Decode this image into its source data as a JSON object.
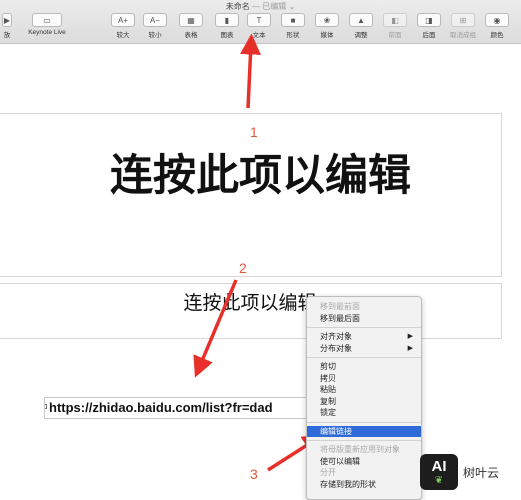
{
  "window": {
    "doc_title": "未命名",
    "doc_status": "— 已编辑 ⌄"
  },
  "toolbar": {
    "items": [
      {
        "label": "放",
        "glyph": "▶",
        "icon": "play-icon",
        "enabled": true
      },
      {
        "label": "Keynote Live",
        "glyph": "▭",
        "icon": "keynote-live-icon",
        "enabled": true
      },
      {
        "label": "较大",
        "glyph": "A+",
        "icon": "font-larger-icon",
        "enabled": true
      },
      {
        "label": "较小",
        "glyph": "A−",
        "icon": "font-smaller-icon",
        "enabled": true
      },
      {
        "label": "表格",
        "glyph": "▦",
        "icon": "table-icon",
        "enabled": true
      },
      {
        "label": "图表",
        "glyph": "▮",
        "icon": "chart-icon",
        "enabled": true
      },
      {
        "label": "文本",
        "glyph": "T",
        "icon": "text-icon",
        "enabled": true
      },
      {
        "label": "形状",
        "glyph": "■",
        "icon": "shape-icon",
        "enabled": true
      },
      {
        "label": "媒体",
        "glyph": "❀",
        "icon": "media-icon",
        "enabled": true
      },
      {
        "label": "调整",
        "glyph": "▲",
        "icon": "adjust-icon",
        "enabled": true
      },
      {
        "label": "前面",
        "glyph": "◧",
        "icon": "bring-front-icon",
        "enabled": false
      },
      {
        "label": "后面",
        "glyph": "◨",
        "icon": "send-back-icon",
        "enabled": true
      },
      {
        "label": "取消成组",
        "glyph": "⊞",
        "icon": "ungroup-icon",
        "enabled": false
      },
      {
        "label": "颜色",
        "glyph": "◉",
        "icon": "color-wheel-icon",
        "enabled": true
      }
    ]
  },
  "slide": {
    "title": "连按此项以编辑",
    "subtitle": "连按此项以编辑",
    "url_text": "https://zhidao.baidu.com/list?fr=dad"
  },
  "annotations": {
    "one": "1",
    "two": "2",
    "three": "3"
  },
  "context_menu": {
    "items": [
      {
        "label": "移到最前面",
        "disabled": true
      },
      {
        "label": "移到最后面"
      },
      {
        "sep": true
      },
      {
        "label": "对齐对象",
        "submenu": true
      },
      {
        "label": "分布对象",
        "submenu": true
      },
      {
        "sep": true
      },
      {
        "label": "剪切"
      },
      {
        "label": "拷贝"
      },
      {
        "label": "粘贴"
      },
      {
        "label": "复制"
      },
      {
        "label": "锁定"
      },
      {
        "sep": true
      },
      {
        "label": "编辑链接",
        "highlighted": true
      },
      {
        "sep": true
      },
      {
        "label": "将母版重新应用到对象",
        "disabled": true
      },
      {
        "label": "使可以编辑"
      },
      {
        "label": "分开",
        "disabled": true
      },
      {
        "label": "存储到我的形状"
      }
    ]
  },
  "watermark": {
    "logo_text": "AI",
    "site": "树叶云"
  },
  "colors": {
    "arrow": "#e8302a",
    "highlight": "#2f6bd8",
    "annotation": "#e05a3a"
  }
}
